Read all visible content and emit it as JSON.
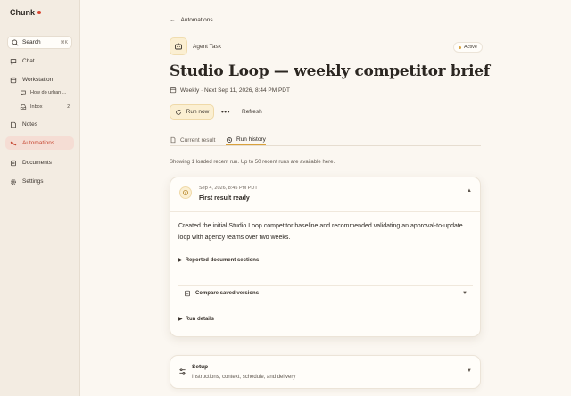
{
  "app": {
    "name": "Chunk",
    "accent": "#d9442f"
  },
  "sidebar": {
    "search": {
      "label": "Search",
      "shortcut": "⌘K"
    },
    "items": [
      {
        "label": "Chat",
        "icon": "chat-icon"
      },
      {
        "label": "Workstation",
        "icon": "workstation-icon"
      },
      {
        "label": "Notes",
        "icon": "notes-icon"
      },
      {
        "label": "Automations",
        "icon": "automations-icon",
        "active": true
      },
      {
        "label": "Documents",
        "icon": "documents-icon"
      },
      {
        "label": "Settings",
        "icon": "settings-icon"
      }
    ],
    "workstation_sub": [
      {
        "label": "How do urban ...",
        "icon": "thread-icon"
      },
      {
        "label": "Inbox",
        "icon": "inbox-icon",
        "count": "2"
      }
    ]
  },
  "header": {
    "back_label": "Automations",
    "agent_label": "Agent Task",
    "status": "Active",
    "title": "Studio Loop — weekly competitor brief",
    "schedule": "Weekly · Next Sep 11, 2026, 8:44 PM PDT",
    "run_now": "Run now",
    "more": "•••",
    "refresh": "Refresh"
  },
  "tabs": [
    {
      "label": "Current result",
      "icon": "document-icon"
    },
    {
      "label": "Run history",
      "icon": "history-icon",
      "selected": true
    }
  ],
  "history_note": "Showing 1 loaded recent run. Up to 50 recent runs are available here.",
  "run": {
    "date": "Sep 4, 2026, 8:45 PM PDT",
    "title": "First result ready",
    "body": "Created the initial Studio Loop competitor baseline and recommended validating an approval-to-update loop with agency teams over two weeks.",
    "sections_label": "Reported document sections",
    "compare_label": "Compare saved versions",
    "details_label": "Run details"
  },
  "setup": {
    "title": "Setup",
    "subtitle": "Instructions, context, schedule, and delivery"
  }
}
